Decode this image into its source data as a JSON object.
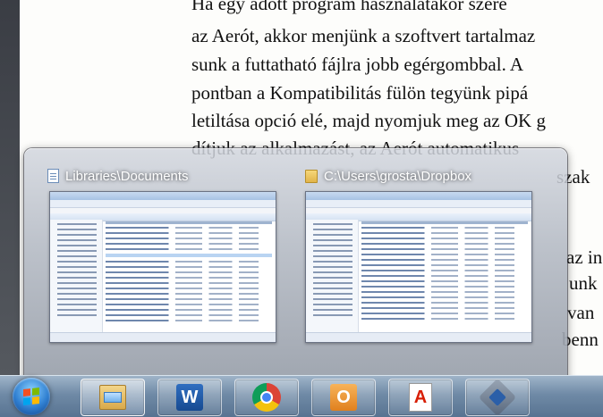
{
  "document": {
    "lines": [
      "Ha egy adott program használatakor szere",
      "az Aerót, akkor menjünk a szoftvert tartalmaz",
      "sunk a futtatható fájlra jobb egérgombbal. A",
      "pontban a Kompatibilitás fülön tegyünk pipá",
      "letiltása opció elé, majd nyomjuk meg az OK g",
      "dítjuk az alkalmazást, az Aerót automatikus",
      "szak"
    ],
    "right_fragments": [
      "az in",
      "unk",
      "van",
      "benn"
    ]
  },
  "peek": {
    "items": [
      {
        "title": "Libraries\\Documents",
        "icon": "library-document-icon"
      },
      {
        "title": "C:\\Users\\grosta\\Dropbox",
        "icon": "folder-icon"
      }
    ]
  },
  "taskbar": {
    "start_icon": "windows-start-icon",
    "buttons": [
      {
        "name": "windows-explorer",
        "icon": "folder-explorer-icon",
        "glyph": ""
      },
      {
        "name": "microsoft-word",
        "icon": "word-icon",
        "glyph": "W"
      },
      {
        "name": "google-chrome",
        "icon": "chrome-icon",
        "glyph": ""
      },
      {
        "name": "microsoft-outlook",
        "icon": "outlook-icon",
        "glyph": "O"
      },
      {
        "name": "adobe-reader",
        "icon": "pdf-icon",
        "glyph": "A"
      },
      {
        "name": "virtualbox",
        "icon": "virtualbox-icon",
        "glyph": ""
      }
    ]
  }
}
